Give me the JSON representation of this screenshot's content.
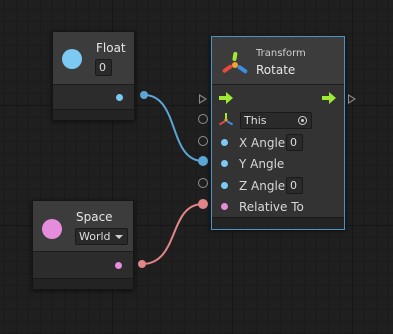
{
  "float_node": {
    "title": "Float",
    "value": "0",
    "color": "#7cc9f4"
  },
  "space_node": {
    "title": "Space",
    "dropdown_value": "World",
    "color": "#e58ddb"
  },
  "transform_node": {
    "category": "Transform",
    "title": "Rotate",
    "rows": {
      "target": {
        "label": "This"
      },
      "x": {
        "label": "X Angle",
        "value": "0"
      },
      "y": {
        "label": "Y Angle"
      },
      "z": {
        "label": "Z Angle",
        "value": "0"
      },
      "relative": {
        "label": "Relative To"
      }
    }
  },
  "colors": {
    "float_wire": "#5aa7d6",
    "space_wire": "#e2858b",
    "flow_arrow": "#9fea35"
  }
}
